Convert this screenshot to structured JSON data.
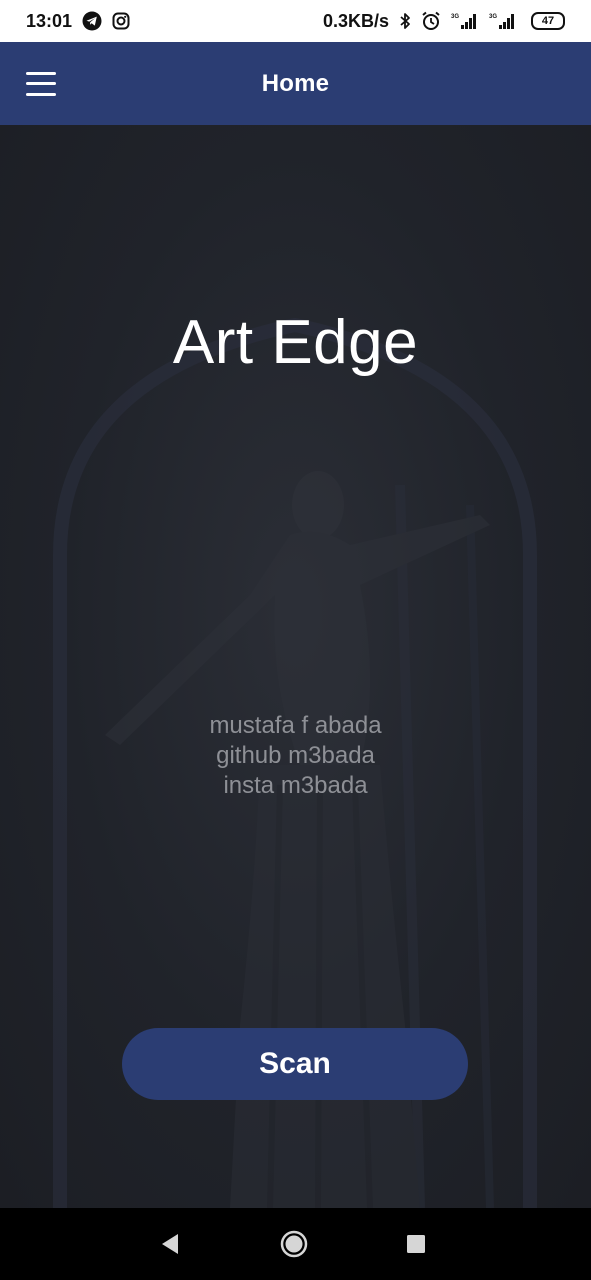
{
  "status_bar": {
    "time": "13:01",
    "net_speed": "0.3KB/s",
    "battery": "47",
    "icons": [
      "telegram-icon",
      "instagram-icon",
      "bluetooth-icon",
      "alarm-icon",
      "signal-3g-icon",
      "signal-3g-icon"
    ]
  },
  "app_bar": {
    "title": "Home",
    "menu_icon": "hamburger-menu-icon"
  },
  "main": {
    "brand_title": "Art Edge",
    "credits": [
      "mustafa f abada",
      "github m3bada",
      "insta m3bada"
    ],
    "scan_label": "Scan"
  },
  "nav_bar": {
    "icons": [
      "back-icon",
      "home-icon",
      "recents-icon"
    ]
  },
  "colors": {
    "primary": "#2b3d73",
    "background": "#20232a",
    "text_primary": "#ffffff",
    "text_muted": "#8e9096"
  }
}
